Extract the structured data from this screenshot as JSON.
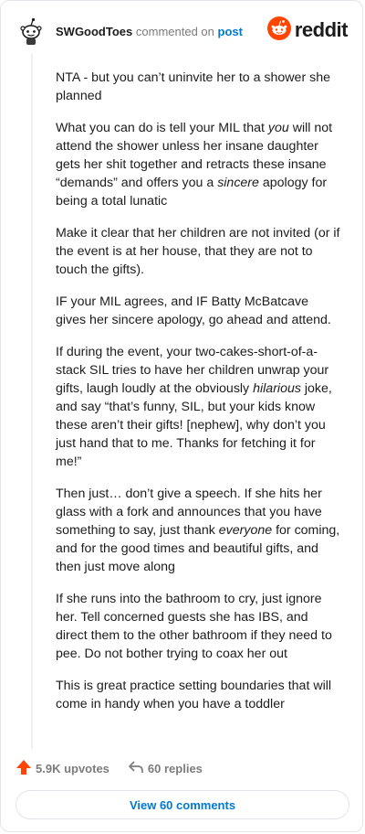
{
  "header": {
    "username": "SWGoodToes",
    "verb": "commented on",
    "post_link": "post",
    "brand": "reddit"
  },
  "comment": {
    "paragraphs": [
      [
        {
          "t": "NTA - but you can’t uninvite her to a shower she planned"
        }
      ],
      [
        {
          "t": "What you can do is tell your MIL that "
        },
        {
          "t": "you",
          "i": true
        },
        {
          "t": " will not attend the shower unless her insane daughter gets her shit together and retracts these insane “demands” and offers you a "
        },
        {
          "t": "sincere",
          "i": true
        },
        {
          "t": " apology for being a total lunatic"
        }
      ],
      [
        {
          "t": "Make it clear that her children are not invited (or if the event is at her house, that they are not to touch the gifts)."
        }
      ],
      [
        {
          "t": "IF your MIL agrees, and IF Batty McBatcave gives her sincere apology, go ahead and attend."
        }
      ],
      [
        {
          "t": "If during the event, your two-cakes-short-of-a-stack SIL tries to have her children unwrap your gifts, laugh loudly at the obviously "
        },
        {
          "t": "hilarious",
          "i": true
        },
        {
          "t": " joke, and say “that’s funny, SIL, but your kids know these aren’t their gifts! [nephew], why don’t you just hand that to me. Thanks for fetching it for me!”"
        }
      ],
      [
        {
          "t": "Then just… don’t give a speech. If she hits her glass with a fork and announces that you have something to say, just thank "
        },
        {
          "t": "everyone",
          "i": true
        },
        {
          "t": " for coming, and for the good times and beautiful gifts, and then just move along"
        }
      ],
      [
        {
          "t": "If she runs into the bathroom to cry, just ignore her. Tell concerned guests she has IBS, and direct them to the other bathroom if they need to pee. Do not bother trying to coax her out"
        }
      ],
      [
        {
          "t": "This is great practice setting boundaries that will come in handy when you have a toddler"
        }
      ]
    ]
  },
  "actions": {
    "upvotes": "5.9K upvotes",
    "replies": "60 replies",
    "view_comments": "View 60 comments"
  },
  "colors": {
    "accent": "#0079d3",
    "upvote": "#ff4500",
    "muted": "#7c7c7c"
  },
  "icons": {
    "avatar": "snoo-avatar-icon",
    "brand": "reddit-logo-icon",
    "upvote": "upvote-arrow-icon",
    "reply": "reply-arrow-icon"
  }
}
